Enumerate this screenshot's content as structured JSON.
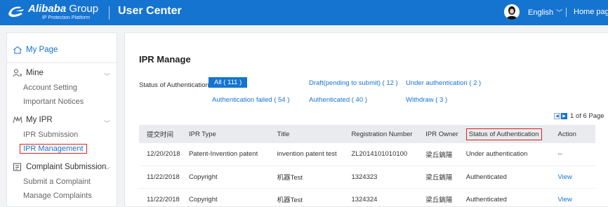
{
  "header": {
    "brand": "Alibaba",
    "brand_group": "Group",
    "brand_sub": "IP Protection Platform",
    "title": "User Center",
    "language": "English",
    "home_link": "Home page",
    "color": "#1674d1"
  },
  "sidebar": {
    "my_page": "My Page",
    "groups": [
      {
        "label": "Mine",
        "icon": "user-icon",
        "items": [
          "Account Setting",
          "Important Notices"
        ]
      },
      {
        "label": "My IPR",
        "icon": "ipr-icon",
        "items": [
          "IPR Submission",
          "IPR Management"
        ]
      },
      {
        "label": "Complaint Submission",
        "icon": "document-icon",
        "items": [
          "Submit a Complaint",
          "Manage Complaints"
        ]
      }
    ]
  },
  "main": {
    "title": "IPR Manage",
    "filter_label": "Status of Authentication：",
    "filters": {
      "all": "All ( 111 )",
      "draft": "Draft(pending to submit) ( 12 )",
      "under": "Under authentication ( 2 )",
      "failed": "Authentication failed ( 54 )",
      "authenticated": "Authenticated ( 40 )",
      "withdraw": "Withdraw ( 3 )"
    },
    "pager": "1 of 6 Page",
    "table": {
      "headers": [
        "提交时间",
        "IPR Type",
        "Title",
        "Registration Number",
        "IPR Owner",
        "Status of Authentication",
        "Action"
      ],
      "rows": [
        [
          "12/20/2018",
          "Patent-Invention patent",
          "invention patent test",
          "ZL2014101010100",
          "梁丘鎬陽",
          "Under authentication",
          "--"
        ],
        [
          "11/22/2018",
          "Copyright",
          "机器Test",
          "1324323",
          "梁丘鎬陽",
          "Authenticated",
          "View"
        ],
        [
          "11/22/2018",
          "Copyright",
          "机器Test",
          "1324324",
          "梁丘鎬陽",
          "Authenticated",
          "View"
        ]
      ]
    }
  }
}
